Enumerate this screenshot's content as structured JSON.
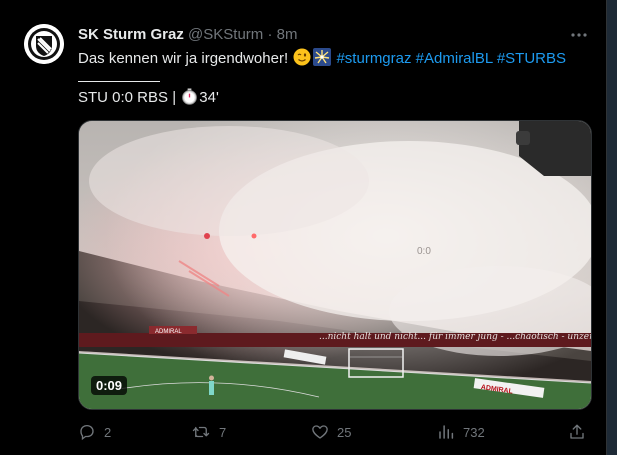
{
  "tweet": {
    "author_name": "SK Sturm Graz",
    "handle": "@SKSturm",
    "separator": " · ",
    "time": "8m",
    "text_main": "Das kennen wir ja irgendwoher!",
    "hashtags": [
      "#sturmgraz",
      "#AdmiralBL",
      "#STURBS"
    ],
    "score": "STU 0:0 RBS |",
    "minute": "34'",
    "more_icon": "ellipsis-icon",
    "emojis": [
      "winking-face-emoji",
      "fireworks-emoji"
    ]
  },
  "media": {
    "duration": "0:09",
    "scene_text": {
      "sponsor": "ADMIRAL",
      "banner": "...nicht halt und nicht... für immer jung - ...chaotisch - unzer...",
      "score_board": "0:0"
    }
  },
  "actions": {
    "reply_count": "2",
    "repost_count": "7",
    "like_count": "25",
    "views_count": "732",
    "icons": [
      "reply-icon",
      "repost-icon",
      "like-icon",
      "views-icon",
      "share-icon"
    ]
  },
  "colors": {
    "background": "#000000",
    "text": "#e7e9ea",
    "secondary": "#71767b",
    "link": "#1d9bf0",
    "pitch": "#3f6f3a"
  }
}
